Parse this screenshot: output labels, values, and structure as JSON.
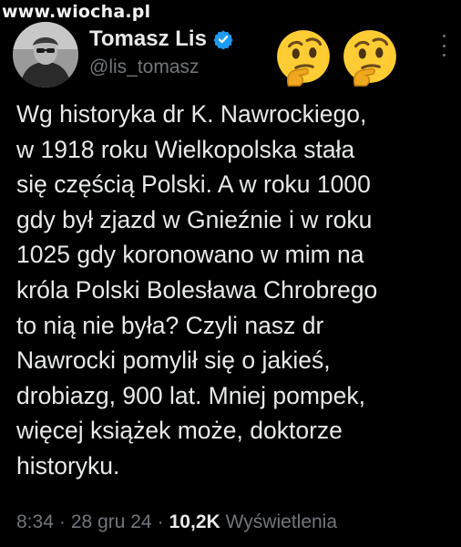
{
  "watermark": "www.wiocha.pl",
  "author": {
    "name": "Tomasz Lis",
    "handle": "@lis_tomasz",
    "verified_color": "#1d9bf0"
  },
  "header_emojis": [
    "thinking-face-emoji",
    "thinking-face-emoji"
  ],
  "menu_icon": "more-vertical-icon",
  "tweet": {
    "lines": [
      "Wg historyka dr K. Nawrockiego,",
      "w 1918 roku Wielkopolska stała",
      "się częścią Polski. A w roku 1000",
      "gdy był zjazd w Gnieźnie i w roku",
      "1025 gdy koronowano w mim na",
      "króla Polski Bolesława Chrobrego",
      "to nią nie była? Czyli nasz dr",
      "Nawrocki pomylił się o jakieś,",
      "drobiazg, 900 lat. Mniej pompek,",
      "więcej książek może, doktorze",
      "historyku."
    ]
  },
  "meta": {
    "time": "8:34",
    "sep1": "·",
    "date": "28 gru 24",
    "sep2": "·",
    "views_count": "10,2K",
    "views_label": "Wyświetlenia"
  },
  "colors": {
    "background": "#000000",
    "text": "#e7e9ea",
    "muted": "#71767b",
    "accent": "#1d9bf0",
    "emoji_yellow": "#ffcc33"
  }
}
